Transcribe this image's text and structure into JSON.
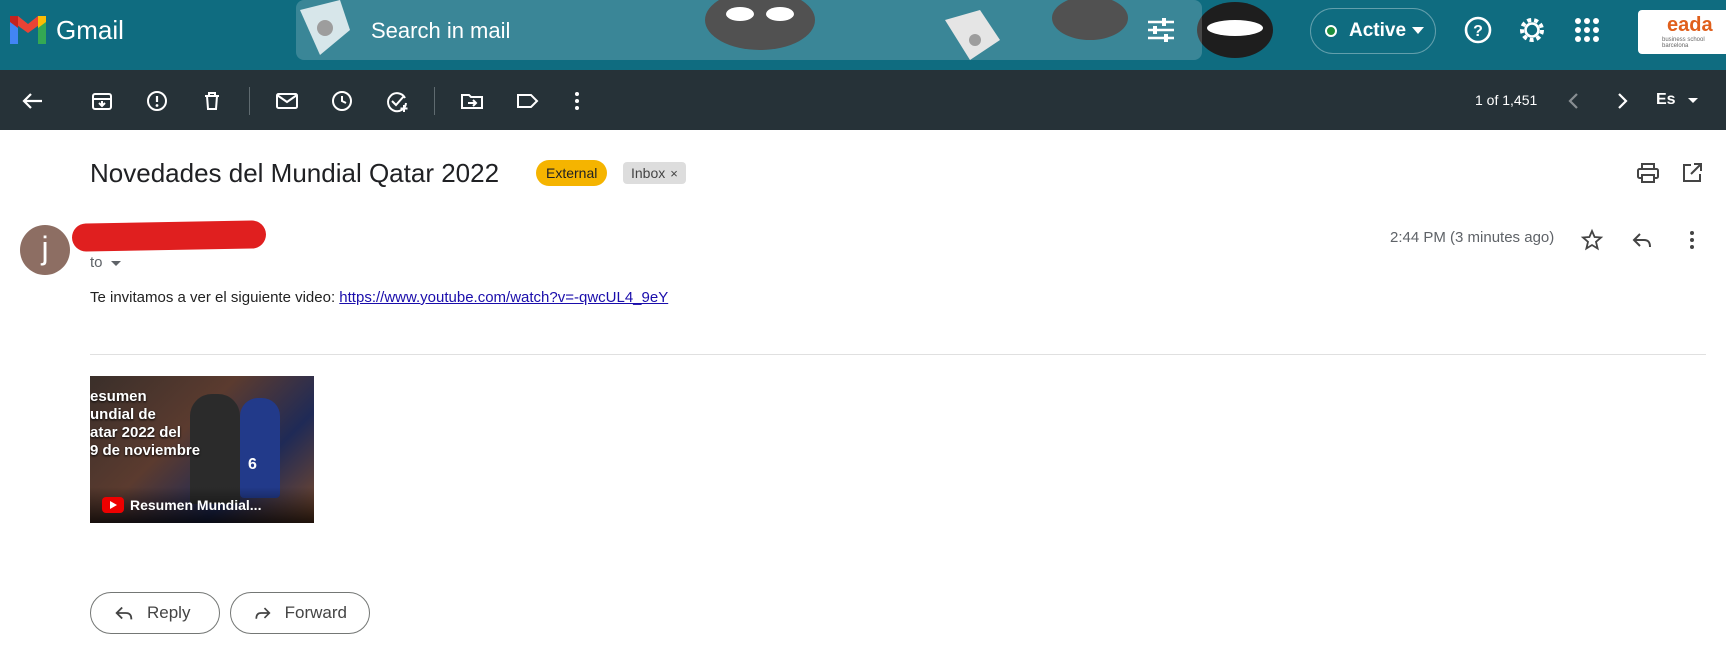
{
  "header": {
    "app_name": "Gmail",
    "search_placeholder": "Search in mail",
    "status": "Active",
    "account_brand": "eada",
    "account_brand_sub": "business school barcelona"
  },
  "toolbar": {
    "pager": "1 of 1,451",
    "input_language": "Es"
  },
  "email": {
    "subject": "Novedades del Mundial Qatar 2022",
    "labels": {
      "external": "External",
      "inbox": "Inbox",
      "inbox_remove": "×"
    },
    "sender_initial": "j",
    "to_label": "to",
    "timestamp": "2:44 PM (3 minutes ago)",
    "body_prefix": "Te invitamos a ver el siguiente video: ",
    "body_link": "https://www.youtube.com/watch?v=-qwcUL4_9eY",
    "video": {
      "headline": "esumen\nundial de\natar 2022 del\n9 de noviembre",
      "caption": "Resumen Mundial...",
      "jersey_number": "6"
    }
  },
  "actions": {
    "reply": "Reply",
    "forward": "Forward"
  },
  "colors": {
    "header_bg": "#0f6c80",
    "toolbar_bg": "#263238",
    "external_label": "#f5b400",
    "redaction": "#e01f1f",
    "avatar": "#8d6e63"
  }
}
